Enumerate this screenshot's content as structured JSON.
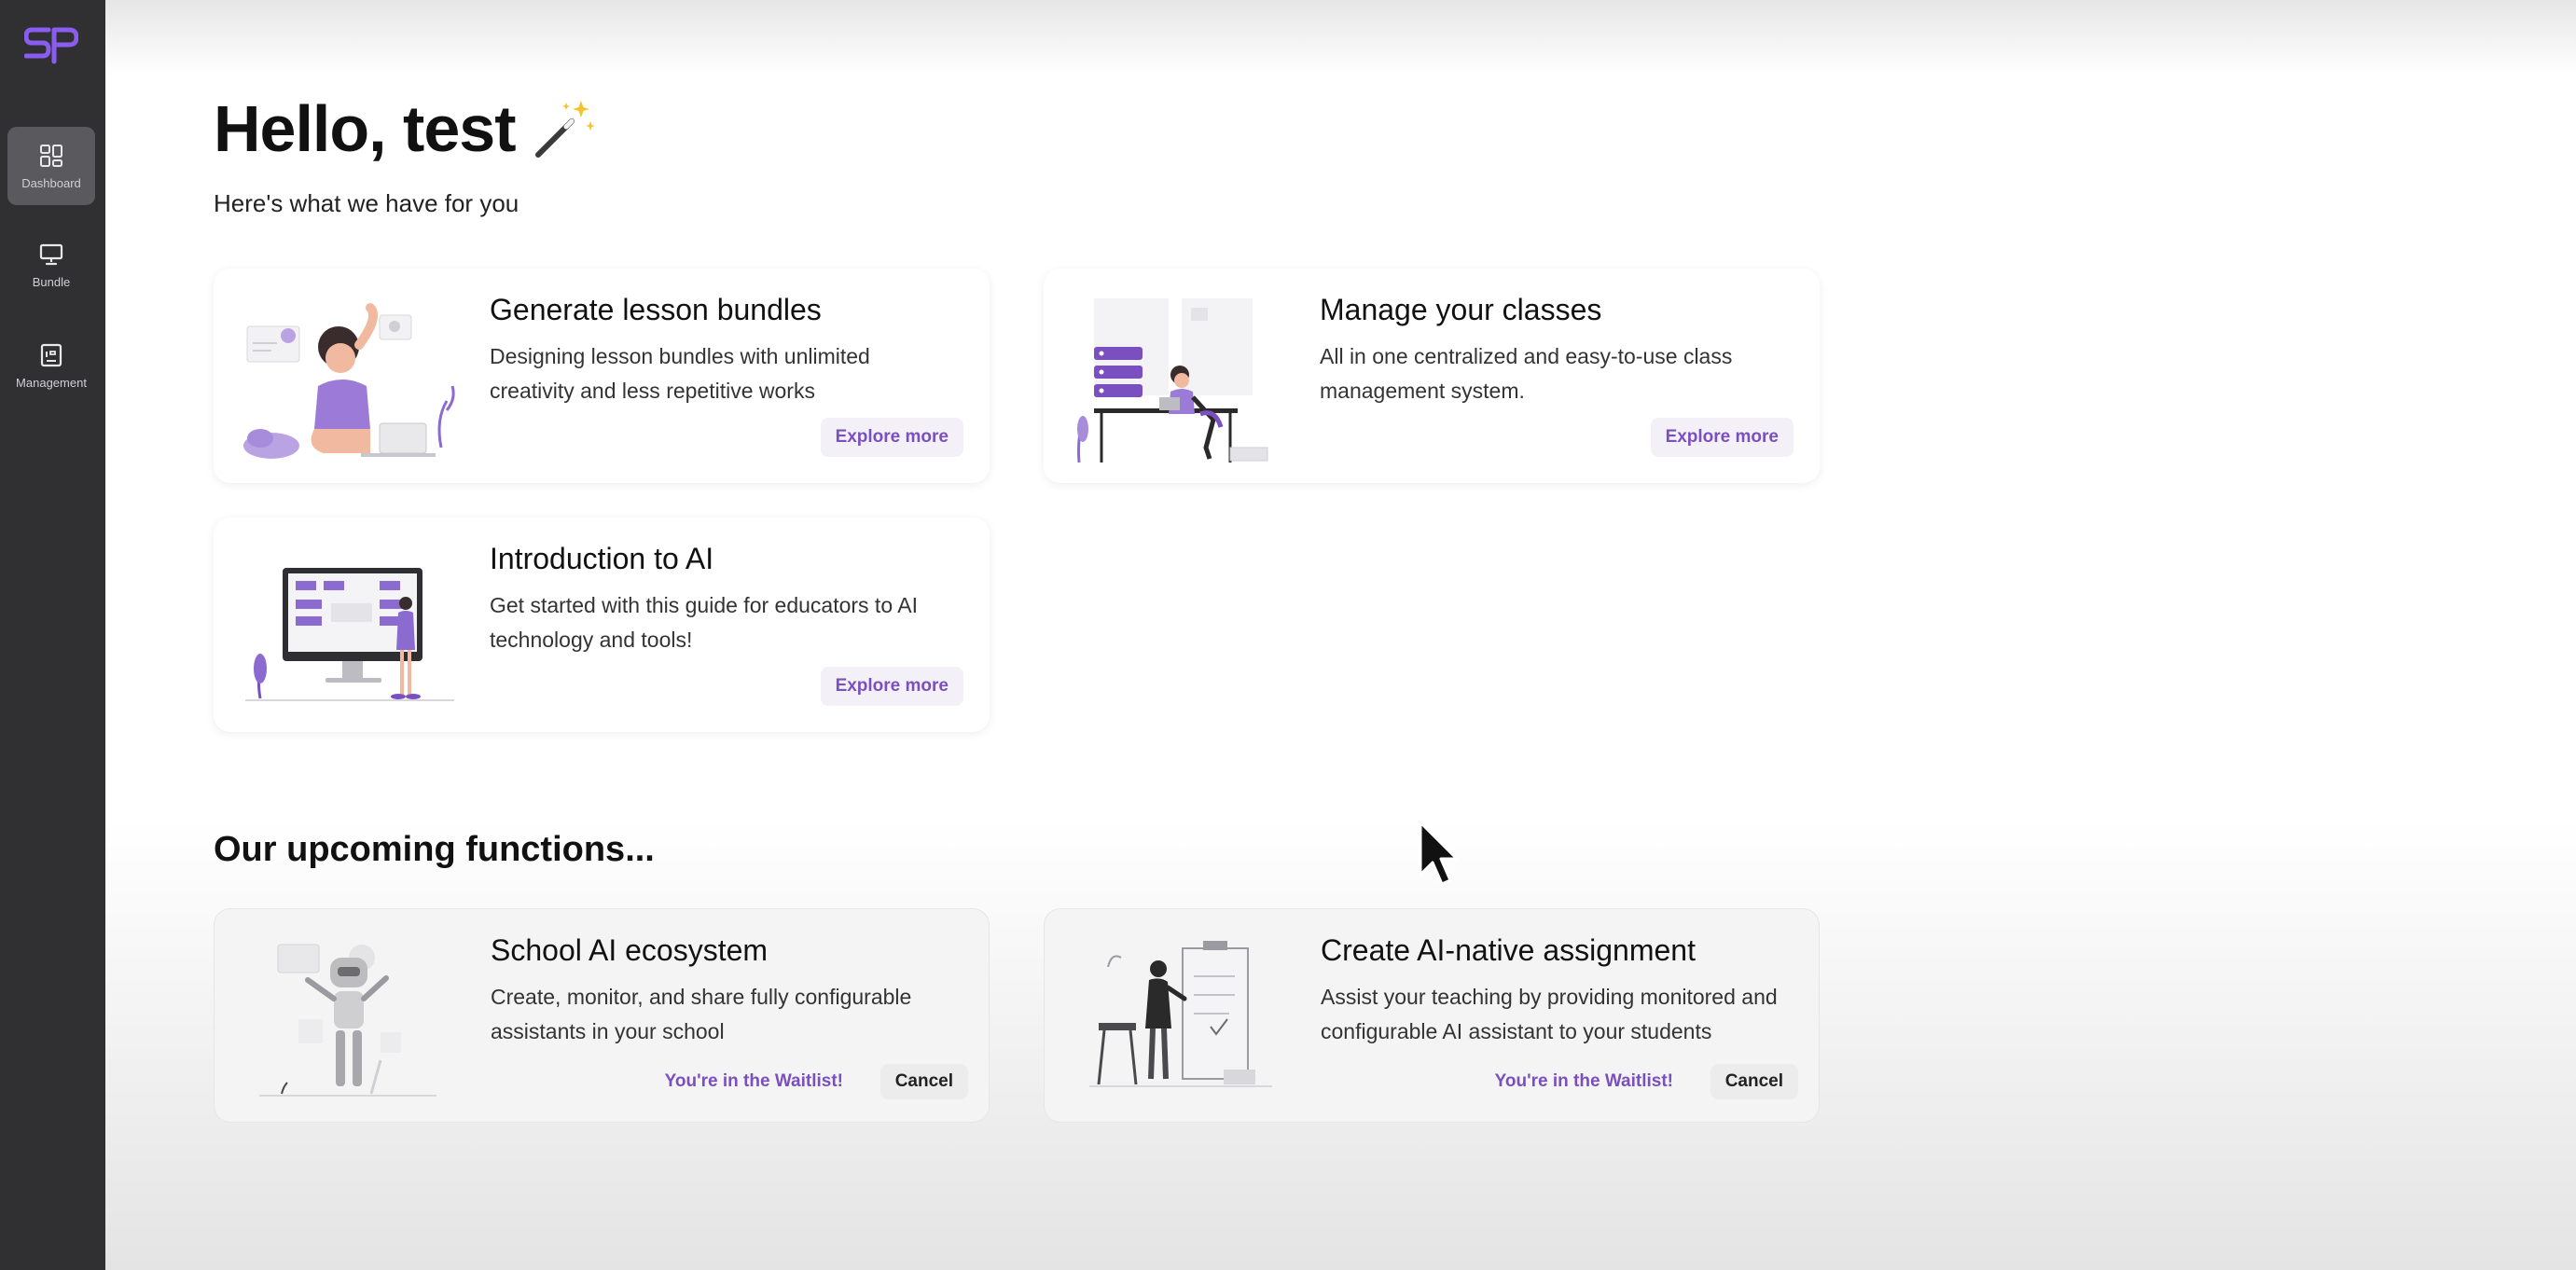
{
  "sidebar": {
    "logo_icon": "sp-logo-icon",
    "items": [
      {
        "label": "Dashboard",
        "icon": "dashboard-grid-icon",
        "active": true
      },
      {
        "label": "Bundle",
        "icon": "presentation-board-icon",
        "active": false
      },
      {
        "label": "Management",
        "icon": "management-id-icon",
        "active": false
      }
    ]
  },
  "header": {
    "greeting": "Hello, test",
    "greeting_icon": "magic-wand-icon",
    "subtitle": "Here's what we have for you"
  },
  "features": [
    {
      "title": "Generate lesson bundles",
      "description": "Designing lesson bundles with unlimited creativity and less repetitive works",
      "button": "Explore more"
    },
    {
      "title": "Manage your classes",
      "description": "All in one centralized and easy-to-use class management system.",
      "button": "Explore more"
    },
    {
      "title": "Introduction to AI",
      "description": "Get started with this guide for educators to AI technology and tools!",
      "button": "Explore more"
    }
  ],
  "upcoming": {
    "title": "Our upcoming functions...",
    "items": [
      {
        "title": "School AI ecosystem",
        "description": "Create, monitor, and share fully configurable assistants in your school",
        "status": "You're in the Waitlist!",
        "cancel": "Cancel"
      },
      {
        "title": "Create AI-native assignment",
        "description": "Assist your teaching by providing monitored and configurable AI assistant to your students",
        "status": "You're in the Waitlist!",
        "cancel": "Cancel"
      }
    ]
  },
  "colors": {
    "sidebar_bg": "#303033",
    "accent_purple": "#7a4fbf",
    "logo_purple": "#8a5cf0"
  }
}
